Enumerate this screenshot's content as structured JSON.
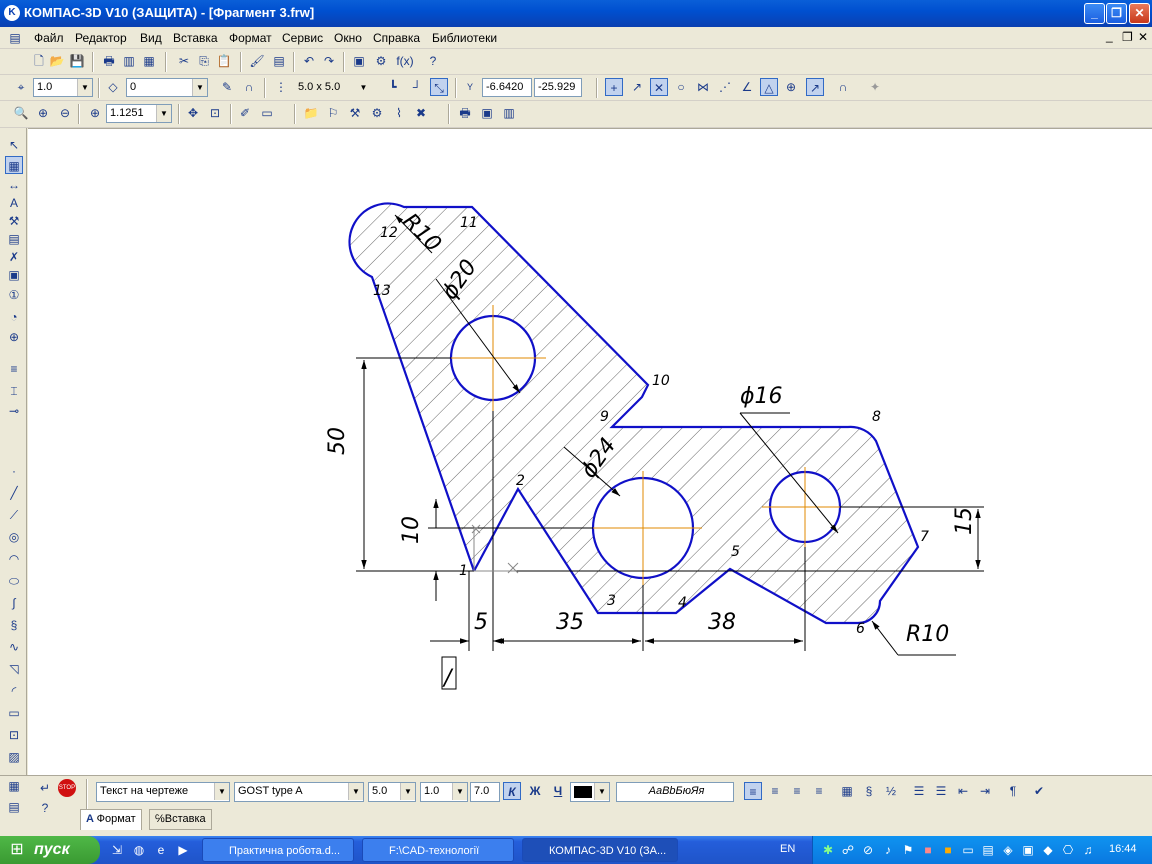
{
  "window": {
    "title": "КОМПАС-3D V10 (ЗАЩИТА) - [Фрагмент 3.frw]",
    "app_icon_letter": "K"
  },
  "menu": [
    "Файл",
    "Редактор",
    "Вид",
    "Вставка",
    "Формат",
    "Сервис",
    "Окно",
    "Справка",
    "Библиотеки"
  ],
  "toolbar2": {
    "step_value": "1.0",
    "layer_value": "0",
    "grid_value": "5.0 x 5.0",
    "coord_y_label": "Y",
    "coord_x": "-6.6420",
    "coord_y": "-25.929"
  },
  "toolbar3": {
    "zoom_value": "1.1251"
  },
  "drawing": {
    "point_labels": [
      "1",
      "2",
      "3",
      "4",
      "5",
      "6",
      "7",
      "8",
      "9",
      "10",
      "11",
      "12",
      "13"
    ],
    "dim_r10_top": "R10",
    "dim_d20": "ϕ20",
    "dim_d24": "ϕ24",
    "dim_d16": "ϕ16",
    "dim_50": "50",
    "dim_10": "10",
    "dim_15": "15",
    "dim_5": "5",
    "dim_35": "35",
    "dim_38": "38",
    "dim_r10_bottom": "R10",
    "cursor_glyph": "/"
  },
  "props": {
    "text_style": "Текст на чертеже",
    "font": "GOST type A",
    "size": "5.0",
    "scale": "1.0",
    "step": "7.0",
    "bold_label": "К",
    "italic_label": "Ж",
    "underline_label": "Ч",
    "sample": "АаВbБюЯя",
    "tab_format": "Формат",
    "tab_insert": "Вставка"
  },
  "taskbar": {
    "start": "пуск",
    "tasks": [
      "Практична робота.d...",
      "F:\\CAD-технології",
      "КОМПАС-3D V10 (ЗА..."
    ],
    "lang": "EN",
    "clock": "16:44"
  }
}
